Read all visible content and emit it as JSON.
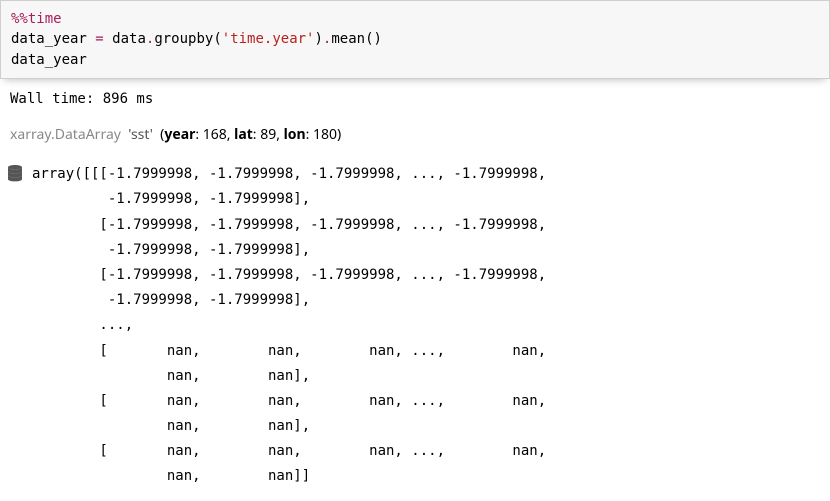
{
  "code": {
    "line1_magic": "%%time",
    "line2_pre": "data_year ",
    "line2_op": "=",
    "line2_mid": " data",
    "line2_dot1": ".",
    "line2_fn1": "groupby(",
    "line2_str": "'time.year'",
    "line2_close1": ")",
    "line2_dot2": ".",
    "line2_fn2": "mean()",
    "line3": "data_year"
  },
  "wall_time": "Wall time: 896 ms",
  "repr": {
    "module": "xarray.DataArray",
    "name": "'sst'",
    "dims_label": "(",
    "dim1k": "year",
    "dim1v": ": 168, ",
    "dim2k": "lat",
    "dim2v": ": 89, ",
    "dim3k": "lon",
    "dim3v": ": 180)"
  },
  "chart_data": {
    "type": "table",
    "title": "xarray.DataArray 'sst' (year: 168, lat: 89, lon: 180)",
    "wall_time_ms": 896,
    "dims": {
      "year": 168,
      "lat": 89,
      "lon": 180
    },
    "sample_fill_value": -1.7999998,
    "has_nan_rows": true
  },
  "array_repr": "array([[[-1.7999998, -1.7999998, -1.7999998, ..., -1.7999998,\n         -1.7999998, -1.7999998],\n        [-1.7999998, -1.7999998, -1.7999998, ..., -1.7999998,\n         -1.7999998, -1.7999998],\n        [-1.7999998, -1.7999998, -1.7999998, ..., -1.7999998,\n         -1.7999998, -1.7999998],\n        ...,\n        [       nan,        nan,        nan, ...,        nan,\n                nan,        nan],\n        [       nan,        nan,        nan, ...,        nan,\n                nan,        nan],\n        [       nan,        nan,        nan, ...,        nan,\n                nan,        nan]]"
}
